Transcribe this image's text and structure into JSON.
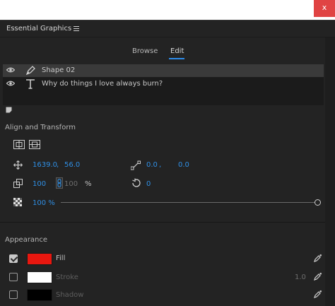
{
  "window": {
    "close_label": "x"
  },
  "panel": {
    "title": "Essential Graphics"
  },
  "tabs": [
    {
      "label": "Browse",
      "active": false
    },
    {
      "label": "Edit",
      "active": true
    }
  ],
  "layers": [
    {
      "name": "Shape 02",
      "type_icon": "pen-icon",
      "selected": true
    },
    {
      "name": "Why do things I love always burn?",
      "type_icon": "text-T-icon",
      "selected": false
    }
  ],
  "align_transform": {
    "title": "Align and Transform",
    "position_x": "1639.0",
    "position_sep": ",",
    "position_y": "56.0",
    "anchor_x": "0.0",
    "anchor_sep": ",",
    "anchor_y": "0.0",
    "scale_w": "100",
    "scale_h": "100",
    "scale_unit": "%",
    "rotation": "0",
    "opacity": "100 %",
    "opacity_value": 100
  },
  "appearance": {
    "title": "Appearance",
    "fill": {
      "label": "Fill",
      "checked": true,
      "color": "#e8170f"
    },
    "stroke": {
      "label": "Stroke",
      "checked": false,
      "color": "#ffffff",
      "width": "1.0"
    },
    "shadow": {
      "label": "Shadow",
      "checked": false,
      "color": "#000000"
    }
  },
  "colors": {
    "accent": "#2d8ceb",
    "value_blue": "#2f8fe5",
    "panel_bg": "#232323"
  }
}
